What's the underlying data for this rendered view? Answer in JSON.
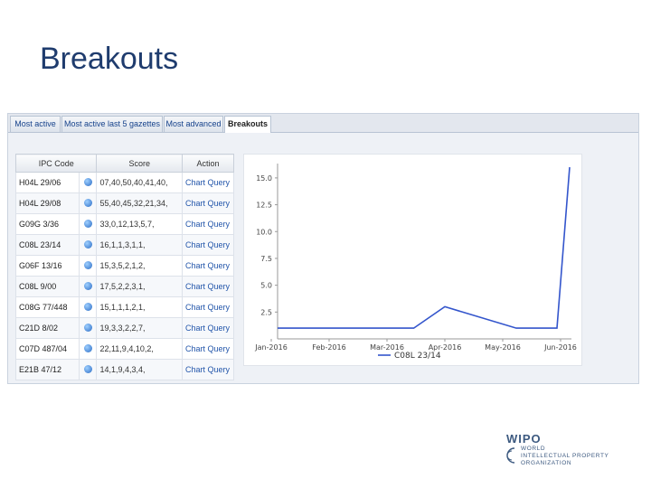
{
  "slide": {
    "title": "Breakouts"
  },
  "tabs": [
    {
      "label": "Most active"
    },
    {
      "label": "Most active last 5 gazettes"
    },
    {
      "label": "Most advanced"
    },
    {
      "label": "Breakouts",
      "active": true
    }
  ],
  "table": {
    "headers": [
      "IPC Code",
      "Score",
      "Action"
    ],
    "rows": [
      {
        "code": "H04L 29/06",
        "score": "07,40,50,40,41,40,",
        "action": "Chart Query"
      },
      {
        "code": "H04L 29/08",
        "score": "55,40,45,32,21,34,",
        "action": "Chart Query"
      },
      {
        "code": "G09G 3/36",
        "score": "33,0,12,13,5,7,",
        "action": "Chart Query"
      },
      {
        "code": "C08L 23/14",
        "score": "16,1,1,3,1,1,",
        "action": "Chart Query"
      },
      {
        "code": "G06F 13/16",
        "score": "15,3,5,2,1,2,",
        "action": "Chart Query"
      },
      {
        "code": "C08L 9/00",
        "score": "17,5,2,2,3,1,",
        "action": "Chart Query"
      },
      {
        "code": "C08G 77/448",
        "score": "15,1,1,1,2,1,",
        "action": "Chart Query"
      },
      {
        "code": "C21D 8/02",
        "score": "19,3,3,2,2,7,",
        "action": "Chart Query"
      },
      {
        "code": "C07D 487/04",
        "score": "22,11,9,4,10,2,",
        "action": "Chart Query"
      },
      {
        "code": "E21B 47/12",
        "score": "14,1,9,4,3,4,",
        "action": "Chart Query"
      }
    ]
  },
  "chart_data": {
    "type": "line",
    "title": "",
    "xlabel": "",
    "ylabel": "",
    "x": [
      "Jan-2016",
      "Feb-2016",
      "Mar-2016",
      "Apr-2016",
      "May-2016",
      "Jun-2016"
    ],
    "xticks": [
      "Jan-2016",
      "Feb-2016",
      "Mar-2016",
      "Apr-2016",
      "May-2016",
      "Jun-2016"
    ],
    "yticks": [
      "15.0",
      "12.5",
      "10.0",
      "7.5",
      "5.0",
      "2.5"
    ],
    "ylim": [
      0,
      16
    ],
    "grid": false,
    "legend": "bottom",
    "color": "#3355cc",
    "series": [
      {
        "name": "C08L 23/14",
        "points": [
          [
            "Jan-2016",
            1
          ],
          [
            "Mar-2016",
            1
          ],
          [
            "Mar-20-2016",
            1
          ],
          [
            "Apr-2016",
            3
          ],
          [
            "May-2016",
            1
          ],
          [
            "Jun-2016",
            1
          ],
          [
            "Jun-2016-end",
            16
          ]
        ]
      }
    ]
  },
  "logo": {
    "name": "WIPO",
    "lines": [
      "WORLD",
      "INTELLECTUAL PROPERTY",
      "ORGANIZATION"
    ]
  }
}
